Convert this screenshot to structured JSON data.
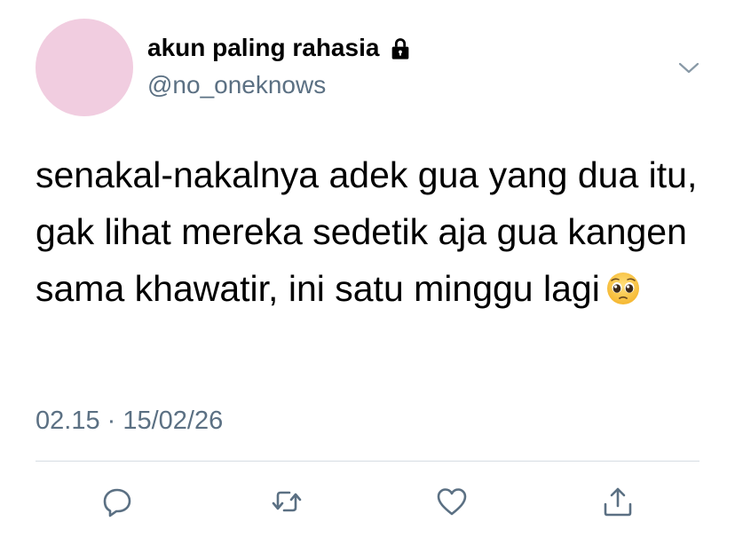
{
  "tweet": {
    "display_name": "akun paling rahasia",
    "handle": "@no_oneknows",
    "text": "senakal-nakalnya adek gua yang dua itu, gak lihat mereka sedetik aja gua kangen sama khawatir, ini satu minggu lagi",
    "emoji": "pleading-face",
    "timestamp": "02.15 · 15/02/26",
    "avatar_color": "#f1cde0",
    "protected_icon": "lock-icon"
  },
  "actions": [
    {
      "name": "reply-icon"
    },
    {
      "name": "retweet-icon"
    },
    {
      "name": "like-icon"
    },
    {
      "name": "share-icon"
    }
  ],
  "colors": {
    "secondary_text": "#5b7083",
    "divider": "#d6dde3",
    "icon": "#5b7083"
  }
}
